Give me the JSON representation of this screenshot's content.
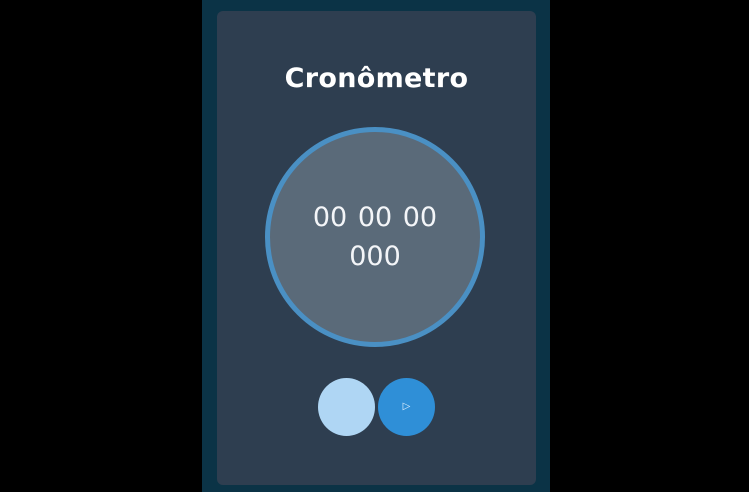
{
  "app": {
    "title": "Cronômetro"
  },
  "timer": {
    "display": "00 00 00 000"
  },
  "controls": {
    "reset_icon": "blank-reset-icon",
    "play_icon": "play-icon",
    "play_glyph": "▷"
  },
  "colors": {
    "background": "#000000",
    "frame": "#0b3346",
    "card": "#2e3e50",
    "dial_fill": "#5a6a79",
    "dial_ring": "#4a90c4",
    "reset_button": "#afd6f4",
    "play_button": "#2f8fd7"
  }
}
